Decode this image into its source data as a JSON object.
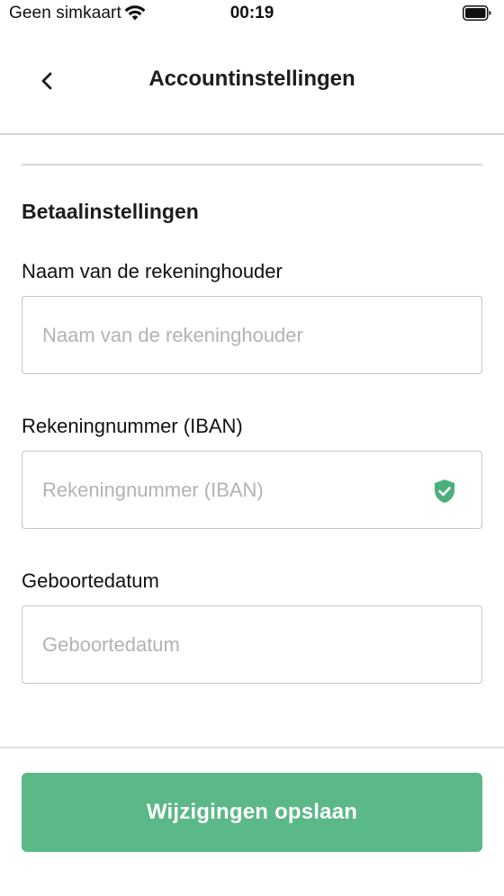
{
  "status_bar": {
    "carrier": "Geen simkaart",
    "time": "00:19",
    "icons": [
      "wifi-icon",
      "battery-icon"
    ]
  },
  "nav": {
    "title": "Accountinstellingen",
    "back_icon": "chevron-left-icon"
  },
  "section": {
    "title": "Betaalinstellingen"
  },
  "fields": [
    {
      "label": "Naam van de rekeninghouder",
      "value": "",
      "placeholder": "Naam van de rekeninghouder"
    },
    {
      "label": "Rekeningnummer (IBAN)",
      "value": "",
      "placeholder": "Rekeningnummer (IBAN)",
      "trailing_icon": "shield-check-icon"
    },
    {
      "label": "Geboortedatum",
      "value": "",
      "placeholder": "Geboortedatum"
    }
  ],
  "footer": {
    "save_label": "Wijzigingen opslaan"
  },
  "colors": {
    "accent": "#5bb887",
    "verified": "#4caf7a",
    "border": "#c4c4c4",
    "placeholder": "#b3b3b3",
    "divider": "#d6d6d6"
  }
}
